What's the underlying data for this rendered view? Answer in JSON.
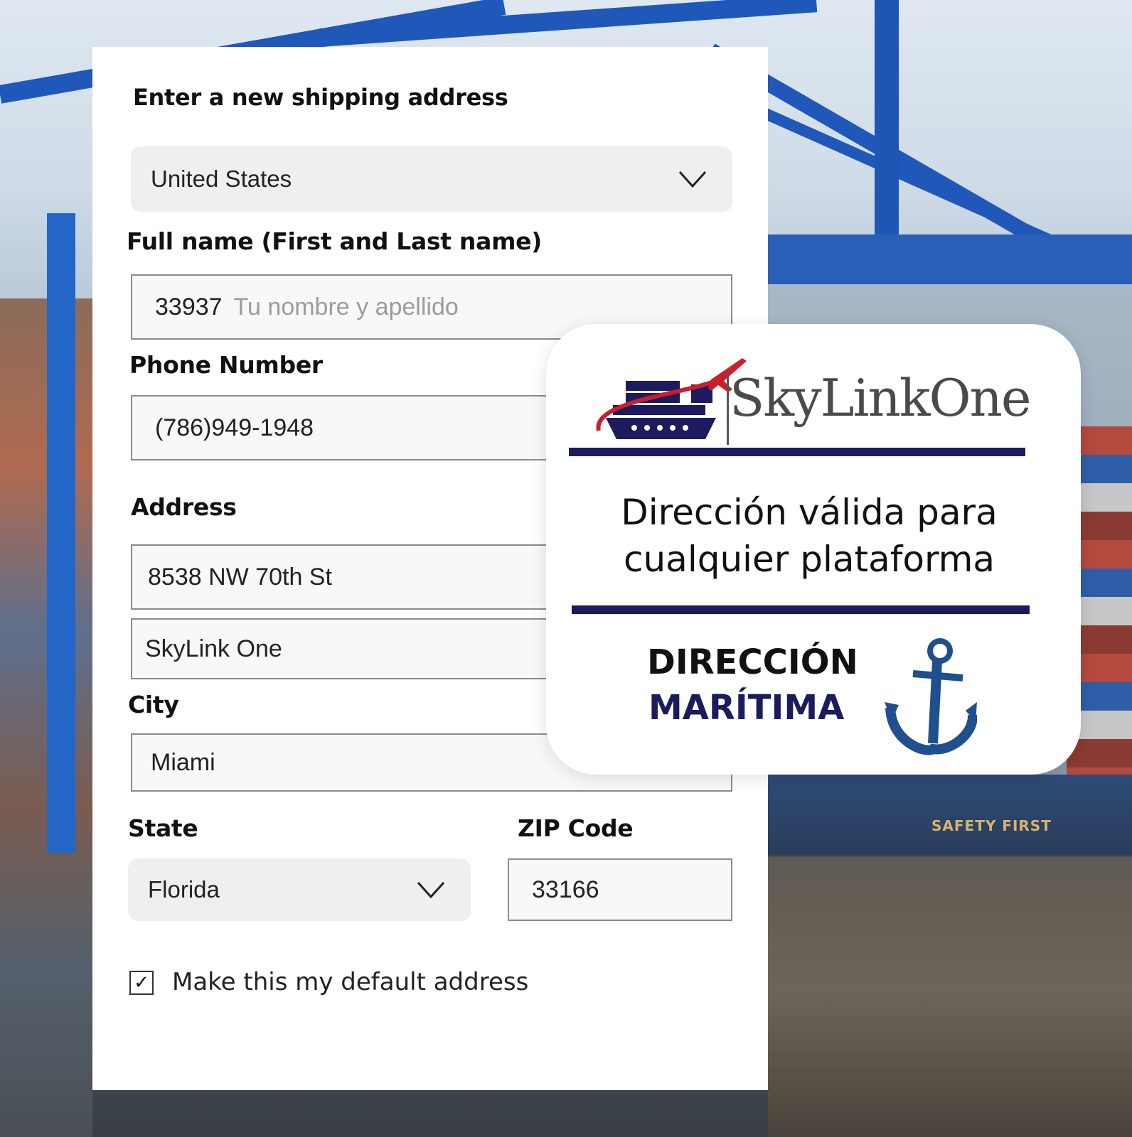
{
  "form": {
    "title": "Enter a new shipping address",
    "country": {
      "value": "United States"
    },
    "full_name": {
      "label": "Full name (First and Last name)",
      "value": "33937",
      "placeholder": "Tu nombre y apellido"
    },
    "phone": {
      "label": "Phone Number",
      "value": "(786)949-1948"
    },
    "address": {
      "label": "Address",
      "line1": "8538 NW 70th St",
      "line2": "SkyLink One"
    },
    "city": {
      "label": "City",
      "value": "Miami"
    },
    "state": {
      "label": "State",
      "value": "Florida"
    },
    "zip": {
      "label": "ZIP Code",
      "value": "33166"
    },
    "default_checkbox": {
      "checked": true,
      "label": "Make this my default address"
    }
  },
  "promo": {
    "brand": "SkyLinkOne",
    "tagline_line1": "Dirección válida para",
    "tagline_line2": "cualquier plataforma",
    "title_line1": "DIRECCIÓN",
    "title_line2": "MARÍTIMA",
    "colors": {
      "navy": "#1c1b5e",
      "accent_red": "#c8202b",
      "anchor": "#1f4f8f"
    }
  },
  "background": {
    "ship_text": "SAFETY FIRST"
  },
  "icons": [
    "chevron-down-icon",
    "check-icon",
    "ship-plane-logo-icon",
    "anchor-icon"
  ]
}
